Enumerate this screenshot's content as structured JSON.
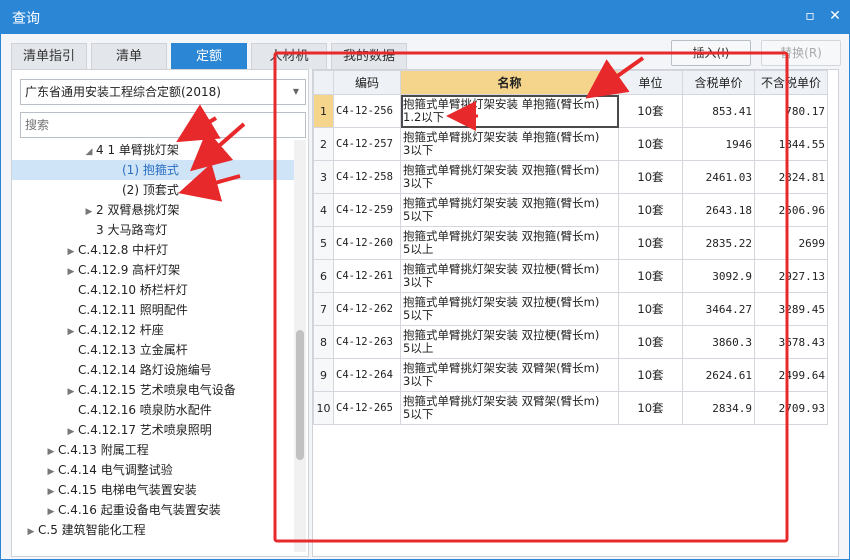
{
  "window": {
    "title": "查询",
    "restore_icon": "restore-icon",
    "close_icon": "close-icon"
  },
  "tabs": [
    {
      "label": "清单指引"
    },
    {
      "label": "清单"
    },
    {
      "label": "定额",
      "active": true
    },
    {
      "label": "人材机"
    },
    {
      "label": "我的数据"
    }
  ],
  "toolbar": {
    "insert_label": "插入(I)",
    "replace_label": "替换(R)"
  },
  "left": {
    "dropdown_value": "广东省通用安装工程综合定额(2018)",
    "search_placeholder": "搜索",
    "tree": [
      {
        "label": "4 1 单臂挑灯架",
        "arrow": "▲"
      },
      {
        "label": "(1) 抱箍式",
        "arrow": "",
        "selected": true
      },
      {
        "label": "(2) 顶套式",
        "arrow": ""
      },
      {
        "label": "2 双臂悬挑灯架",
        "arrow": "▶"
      },
      {
        "label": "3 大马路弯灯",
        "arrow": ""
      },
      {
        "label": "C.4.12.8 中杆灯",
        "arrow": "▶"
      },
      {
        "label": "C.4.12.9 高杆灯架",
        "arrow": "▶"
      },
      {
        "label": "C.4.12.10 桥栏杆灯",
        "arrow": ""
      },
      {
        "label": "C.4.12.11 照明配件",
        "arrow": ""
      },
      {
        "label": "C.4.12.12 杆座",
        "arrow": "▶"
      },
      {
        "label": "C.4.12.13 立金属杆",
        "arrow": ""
      },
      {
        "label": "C.4.12.14 路灯设施编号",
        "arrow": ""
      },
      {
        "label": "C.4.12.15 艺术喷泉电气设备",
        "arrow": "▶"
      },
      {
        "label": "C.4.12.16 喷泉防水配件",
        "arrow": ""
      },
      {
        "label": "C.4.12.17 艺术喷泉照明",
        "arrow": "▶"
      },
      {
        "label": "C.4.13 附属工程",
        "arrow": "▶"
      },
      {
        "label": "C.4.14 电气调整试验",
        "arrow": "▶"
      },
      {
        "label": "C.4.15 电梯电气装置安装",
        "arrow": "▶"
      },
      {
        "label": "C.4.16 起重设备电气装置安装",
        "arrow": "▶"
      },
      {
        "label": "C.5 建筑智能化工程",
        "arrow": "▶"
      }
    ]
  },
  "table": {
    "headers": [
      "",
      "编码",
      "名称",
      "单位",
      "含税单价",
      "不含税单价"
    ],
    "rows": [
      {
        "idx": "1",
        "code": "C4-12-256",
        "name": "抱箍式单臂挑灯架安装 单抱箍(臂长m)\n1.2以下",
        "unit": "10套",
        "price_tax": "853.41",
        "price_notax": "780.17"
      },
      {
        "idx": "2",
        "code": "C4-12-257",
        "name": "抱箍式单臂挑灯架安装 单抱箍(臂长m)\n3以下",
        "unit": "10套",
        "price_tax": "1946",
        "price_notax": "1844.55"
      },
      {
        "idx": "3",
        "code": "C4-12-258",
        "name": "抱箍式单臂挑灯架安装 双抱箍(臂长m)\n3以下",
        "unit": "10套",
        "price_tax": "2461.03",
        "price_notax": "2324.81"
      },
      {
        "idx": "4",
        "code": "C4-12-259",
        "name": "抱箍式单臂挑灯架安装 双抱箍(臂长m)\n5以下",
        "unit": "10套",
        "price_tax": "2643.18",
        "price_notax": "2506.96"
      },
      {
        "idx": "5",
        "code": "C4-12-260",
        "name": "抱箍式单臂挑灯架安装 双抱箍(臂长m)\n5以上",
        "unit": "10套",
        "price_tax": "2835.22",
        "price_notax": "2699"
      },
      {
        "idx": "6",
        "code": "C4-12-261",
        "name": "抱箍式单臂挑灯架安装 双拉梗(臂长m)\n3以下",
        "unit": "10套",
        "price_tax": "3092.9",
        "price_notax": "2927.13"
      },
      {
        "idx": "7",
        "code": "C4-12-262",
        "name": "抱箍式单臂挑灯架安装 双拉梗(臂长m)\n5以下",
        "unit": "10套",
        "price_tax": "3464.27",
        "price_notax": "3289.45"
      },
      {
        "idx": "8",
        "code": "C4-12-263",
        "name": "抱箍式单臂挑灯架安装 双拉梗(臂长m)\n5以上",
        "unit": "10套",
        "price_tax": "3860.3",
        "price_notax": "3678.43"
      },
      {
        "idx": "9",
        "code": "C4-12-264",
        "name": "抱箍式单臂挑灯架安装 双臂架(臂长m)\n3以下",
        "unit": "10套",
        "price_tax": "2624.61",
        "price_notax": "2499.64"
      },
      {
        "idx": "10",
        "code": "C4-12-265",
        "name": "抱箍式单臂挑灯架安装 双臂架(臂长m)\n5以下",
        "unit": "10套",
        "price_tax": "2834.9",
        "price_notax": "2709.93"
      }
    ]
  },
  "colors": {
    "accent": "#2b86d6",
    "annotation": "#e8292b",
    "selection": "#f5d58b"
  }
}
